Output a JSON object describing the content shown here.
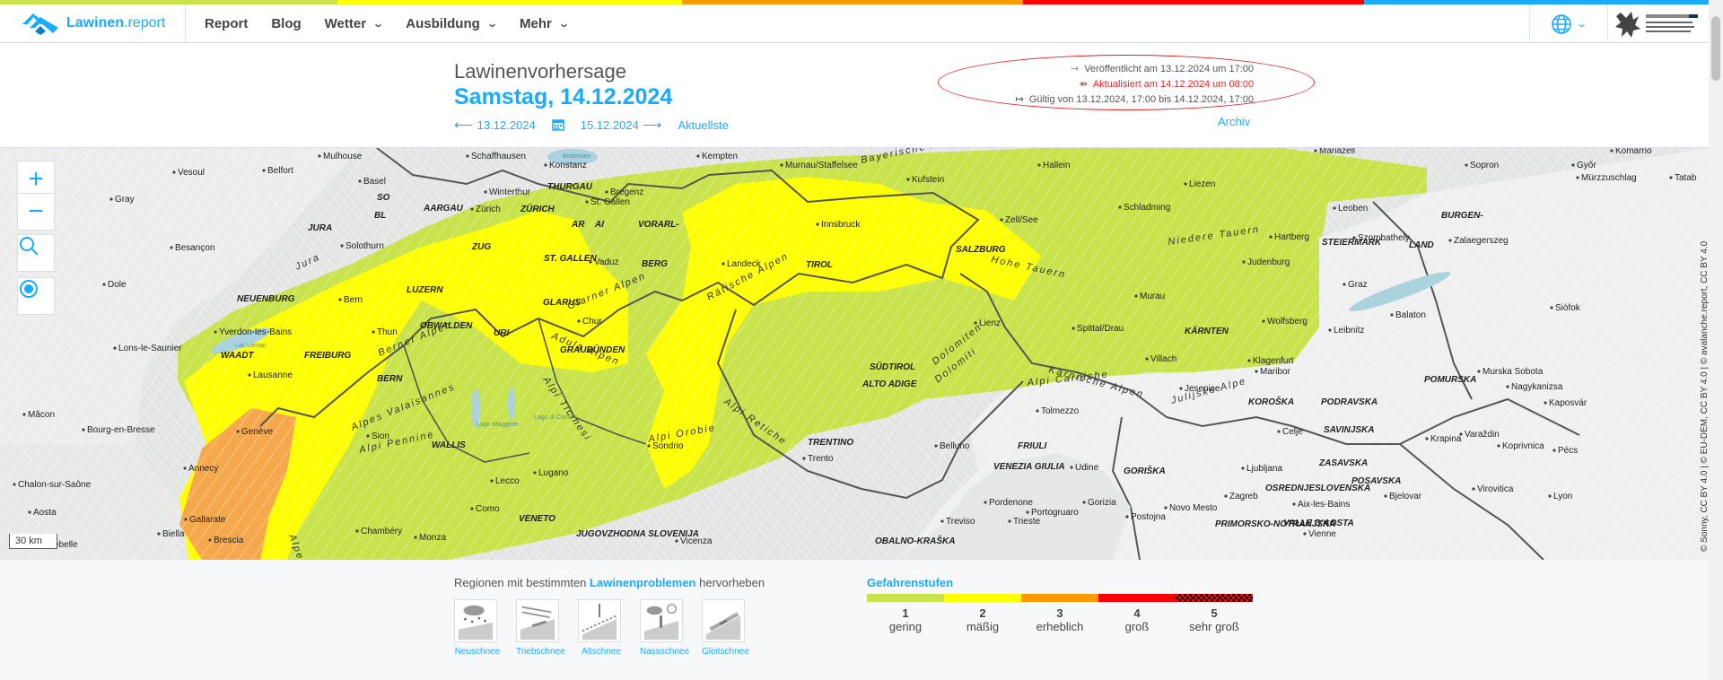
{
  "top_stripe": [
    "#c8e34c",
    "#ffff00",
    "#ff9a00",
    "#ff0000",
    "#19abff"
  ],
  "header": {
    "logo_brand": "Lawinen",
    "logo_suffix": ".report",
    "nav": [
      {
        "label": "Report",
        "dropdown": false
      },
      {
        "label": "Blog",
        "dropdown": false
      },
      {
        "label": "Wetter",
        "dropdown": true
      },
      {
        "label": "Ausbildung",
        "dropdown": true
      },
      {
        "label": "Mehr",
        "dropdown": true
      }
    ],
    "language_icon": "globe-icon"
  },
  "bulletin": {
    "label": "Lawinenvorhersage",
    "date": "Samstag, 14.12.2024",
    "prev_date": "13.12.2024",
    "next_date": "15.12.2024",
    "latest": "Aktuellste",
    "published": "Veröffentlicht am 13.12.2024 um 17:00",
    "updated": "Aktualisiert am 14.12.2024 um 08:00",
    "valid": "Gültig von 13.12.2024, 17:00 bis 14.12.2024, 17:00",
    "archive": "Archiv"
  },
  "map": {
    "scale": "30 km",
    "attribution": "© Sonny, CC BY 4.0 | © EU-DEM, CC BY 4.0 | © avalanche.report, CC BY 4.0",
    "labels": [
      {
        "t": "Mulhouse",
        "c": "city"
      },
      {
        "t": "Schaffhausen",
        "c": "city"
      },
      {
        "t": "Konstanz",
        "c": "city"
      },
      {
        "t": "Kempten",
        "c": "city"
      },
      {
        "t": "Murnau/Staffelsee",
        "c": "city"
      },
      {
        "t": "Hallein",
        "c": "city"
      },
      {
        "t": "Mariazell",
        "c": "city"
      },
      {
        "t": "Komárno",
        "c": "city"
      },
      {
        "t": "Vesoul",
        "c": "city"
      },
      {
        "t": "Belfort",
        "c": "city"
      },
      {
        "t": "Basel",
        "c": "city"
      },
      {
        "t": "Winterthur",
        "c": "city"
      },
      {
        "t": "THURGAU",
        "c": "region"
      },
      {
        "t": "Bregenz",
        "c": "city"
      },
      {
        "t": "Kufstein",
        "c": "city"
      },
      {
        "t": "Mürzzuschlag",
        "c": "city"
      },
      {
        "t": "Sopron",
        "c": "city"
      },
      {
        "t": "Győr",
        "c": "city"
      },
      {
        "t": "Tatab",
        "c": "city"
      },
      {
        "t": "Gray",
        "c": "city"
      },
      {
        "t": "SO",
        "c": "region"
      },
      {
        "t": "AARGAU",
        "c": "region"
      },
      {
        "t": "Zürich",
        "c": "city"
      },
      {
        "t": "ZÜRICH",
        "c": "region"
      },
      {
        "t": "St. Gallen",
        "c": "city"
      },
      {
        "t": "Liezen",
        "c": "city"
      },
      {
        "t": "Schladming",
        "c": "city"
      },
      {
        "t": "Leoben",
        "c": "city"
      },
      {
        "t": "BURGEN-",
        "c": "region"
      },
      {
        "t": "JURA",
        "c": "region"
      },
      {
        "t": "BL",
        "c": "region"
      },
      {
        "t": "AR",
        "c": "region"
      },
      {
        "t": "AI",
        "c": "region"
      },
      {
        "t": "VORARL-",
        "c": "region"
      },
      {
        "t": "Innsbruck",
        "c": "city"
      },
      {
        "t": "Zell/See",
        "c": "city"
      },
      {
        "t": "Hartberg",
        "c": "city"
      },
      {
        "t": "Szombathely",
        "c": "city"
      },
      {
        "t": "Besançon",
        "c": "city"
      },
      {
        "t": "Solothurn",
        "c": "city"
      },
      {
        "t": "ZUG",
        "c": "region"
      },
      {
        "t": "ST. GALLEN",
        "c": "region"
      },
      {
        "t": "Vaduz",
        "c": "city"
      },
      {
        "t": "BERG",
        "c": "region"
      },
      {
        "t": "Landeck",
        "c": "city"
      },
      {
        "t": "TIROL",
        "c": "region"
      },
      {
        "t": "SALZBURG",
        "c": "region"
      },
      {
        "t": "Judenburg",
        "c": "city"
      },
      {
        "t": "STEIERMARK",
        "c": "region"
      },
      {
        "t": "LAND",
        "c": "region"
      },
      {
        "t": "Zalaegerszeg",
        "c": "city"
      },
      {
        "t": "Dole",
        "c": "city"
      },
      {
        "t": "LUZERN",
        "c": "region"
      },
      {
        "t": "Graz",
        "c": "city"
      },
      {
        "t": "Murau",
        "c": "city"
      },
      {
        "t": "NEUENBURG",
        "c": "region"
      },
      {
        "t": "Bern",
        "c": "city"
      },
      {
        "t": "GLARUS",
        "c": "region"
      },
      {
        "t": "Lienz",
        "c": "city"
      },
      {
        "t": "Wolfsberg",
        "c": "city"
      },
      {
        "t": "Leibnitz",
        "c": "city"
      },
      {
        "t": "Siófok",
        "c": "city"
      },
      {
        "t": "Yverdon-les-Bains",
        "c": "city"
      },
      {
        "t": "OBWALDEN",
        "c": "region"
      },
      {
        "t": "URI",
        "c": "region"
      },
      {
        "t": "Chur",
        "c": "city"
      },
      {
        "t": "Spittal/Drau",
        "c": "city"
      },
      {
        "t": "KÄRNTEN",
        "c": "region"
      },
      {
        "t": "Balaton",
        "c": "city"
      },
      {
        "t": "Lons-le-Saunier",
        "c": "city"
      },
      {
        "t": "Thun",
        "c": "city"
      },
      {
        "t": "FREIBURG",
        "c": "region"
      },
      {
        "t": "WAADT",
        "c": "region"
      },
      {
        "t": "GRAUBÜNDEN",
        "c": "region"
      },
      {
        "t": "SÜDTIROL",
        "c": "region"
      },
      {
        "t": "ALTO ADIGE",
        "c": "region"
      },
      {
        "t": "Villach",
        "c": "city"
      },
      {
        "t": "Klagenfurt",
        "c": "city"
      },
      {
        "t": "Maribor",
        "c": "city"
      },
      {
        "t": "Murska Sobota",
        "c": "city"
      },
      {
        "t": "POMURSKA",
        "c": "region"
      },
      {
        "t": "Nagykanizsa",
        "c": "city"
      },
      {
        "t": "Lausanne",
        "c": "city"
      },
      {
        "t": "BERN",
        "c": "region"
      },
      {
        "t": "Jesenice",
        "c": "city"
      },
      {
        "t": "KOROŠKA",
        "c": "region"
      },
      {
        "t": "PODRAVSKA",
        "c": "region"
      },
      {
        "t": "Kaposvár",
        "c": "city"
      },
      {
        "t": "Mâcon",
        "c": "city"
      },
      {
        "t": "Tolmezzo",
        "c": "city"
      },
      {
        "t": "SAVINJSKA",
        "c": "region"
      },
      {
        "t": "Celje",
        "c": "city"
      },
      {
        "t": "Varaždin",
        "c": "city"
      },
      {
        "t": "Bourg-en-Bresse",
        "c": "city"
      },
      {
        "t": "Genève",
        "c": "city"
      },
      {
        "t": "Sion",
        "c": "city"
      },
      {
        "t": "WALLIS",
        "c": "region"
      },
      {
        "t": "Sondrio",
        "c": "city"
      },
      {
        "t": "FRIULI",
        "c": "region"
      },
      {
        "t": "Krapina",
        "c": "city"
      },
      {
        "t": "Koprivnica",
        "c": "city"
      },
      {
        "t": "TRENTINO",
        "c": "region"
      },
      {
        "t": "Belluno",
        "c": "city"
      },
      {
        "t": "VENEZIA GIULIA",
        "c": "region"
      },
      {
        "t": "ZASAVSKA",
        "c": "region"
      },
      {
        "t": "Pécs",
        "c": "city"
      },
      {
        "t": "Annecy",
        "c": "city"
      },
      {
        "t": "Lugano",
        "c": "city"
      },
      {
        "t": "Trento",
        "c": "city"
      },
      {
        "t": "Udine",
        "c": "city"
      },
      {
        "t": "Ljubljana",
        "c": "city"
      },
      {
        "t": "GORIŠKA",
        "c": "region"
      },
      {
        "t": "OSREDNJESLOVENSKA",
        "c": "region"
      },
      {
        "t": "POSAVSKA",
        "c": "region"
      },
      {
        "t": "Chalon-sur-Saône",
        "c": "city"
      },
      {
        "t": "Lecco",
        "c": "city"
      },
      {
        "t": "Pordenone",
        "c": "city"
      },
      {
        "t": "Gorizia",
        "c": "city"
      },
      {
        "t": "Zagreb",
        "c": "city"
      },
      {
        "t": "Bjelovar",
        "c": "city"
      },
      {
        "t": "Virovitica",
        "c": "city"
      },
      {
        "t": "Lyon",
        "c": "city"
      },
      {
        "t": "Aosta",
        "c": "city"
      },
      {
        "t": "Como",
        "c": "city"
      },
      {
        "t": "Portogruaro",
        "c": "city"
      },
      {
        "t": "Postojna",
        "c": "city"
      },
      {
        "t": "Novo Mesto",
        "c": "city"
      },
      {
        "t": "Aix-les-Bains",
        "c": "city"
      },
      {
        "t": "Gallarate",
        "c": "city"
      },
      {
        "t": "VENETO",
        "c": "region"
      },
      {
        "t": "Treviso",
        "c": "city"
      },
      {
        "t": "Trieste",
        "c": "city"
      },
      {
        "t": "PRIMORSKO-NOTRANJSKA",
        "c": "region"
      },
      {
        "t": "VALLE D'AOSTA",
        "c": "region"
      },
      {
        "t": "Chambéry",
        "c": "city"
      },
      {
        "t": "Biella",
        "c": "city"
      },
      {
        "t": "Monza",
        "c": "city"
      },
      {
        "t": "JUGOVZHODNA SLOVENIJA",
        "c": "region"
      },
      {
        "t": "Vienne",
        "c": "city"
      },
      {
        "t": "Aiguebelle",
        "c": "city"
      },
      {
        "t": "Brescia",
        "c": "city"
      },
      {
        "t": "Vicenza",
        "c": "city"
      },
      {
        "t": "OBALNO-KRAŠKA",
        "c": "region"
      },
      {
        "t": "Bayerische Alpen",
        "c": "range"
      },
      {
        "t": "Hohe Tauern",
        "c": "range"
      },
      {
        "t": "Niedere Tauern",
        "c": "range"
      },
      {
        "t": "Jura",
        "c": "range"
      },
      {
        "t": "Glarner Alpen",
        "c": "range"
      },
      {
        "t": "Rätische Alpen",
        "c": "range"
      },
      {
        "t": "Adula Alpen",
        "c": "range"
      },
      {
        "t": "Berner Alpen",
        "c": "range"
      },
      {
        "t": "Alpi Ticinesi",
        "c": "range"
      },
      {
        "t": "Alpi Retiche",
        "c": "range"
      },
      {
        "t": "Dolomiten",
        "c": "range"
      },
      {
        "t": "Dolomiti",
        "c": "range"
      },
      {
        "t": "Karnische Alpen",
        "c": "range"
      },
      {
        "t": "Alpi Carniche",
        "c": "range"
      },
      {
        "t": "Julijske Alpe",
        "c": "range"
      },
      {
        "t": "Alpes Valaisannes",
        "c": "range"
      },
      {
        "t": "Alpi Pennine",
        "c": "range"
      },
      {
        "t": "Alpi Orobie",
        "c": "range"
      },
      {
        "t": "Alpes",
        "c": "range"
      },
      {
        "t": "Lago Maggiore",
        "c": "water"
      },
      {
        "t": "Lago di Como",
        "c": "water"
      },
      {
        "t": "Bodensee",
        "c": "water"
      },
      {
        "t": "Lac Léman",
        "c": "water"
      }
    ]
  },
  "problems": {
    "title_prefix": "Regionen mit bestimmten",
    "title_link": "Lawinenproblemen",
    "title_suffix": "hervorheben",
    "items": [
      {
        "label": "Neuschnee",
        "icon": "new-snow-icon"
      },
      {
        "label": "Triebschnee",
        "icon": "wind-slab-icon"
      },
      {
        "label": "Altschnee",
        "icon": "persistent-weak-layer-icon"
      },
      {
        "label": "Nassschnee",
        "icon": "wet-snow-icon"
      },
      {
        "label": "Gleitschnee",
        "icon": "gliding-snow-icon"
      }
    ]
  },
  "danger": {
    "title": "Gefahrenstufen",
    "levels": [
      {
        "num": "1",
        "label": "gering",
        "color": "#c8e34c"
      },
      {
        "num": "2",
        "label": "mäßig",
        "color": "#ffff00"
      },
      {
        "num": "3",
        "label": "erheblich",
        "color": "#ff9a00"
      },
      {
        "num": "4",
        "label": "groß",
        "color": "#ff0000"
      },
      {
        "num": "5",
        "label": "sehr groß",
        "color": "#c00000"
      }
    ]
  }
}
